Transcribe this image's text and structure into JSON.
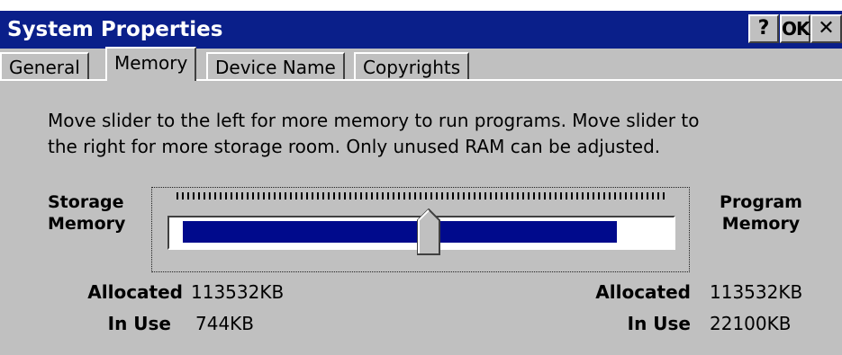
{
  "window": {
    "title": "System Properties",
    "buttons": {
      "help": "?",
      "ok": "OK",
      "close": "✕"
    }
  },
  "tabs": [
    {
      "label": "General",
      "active": false
    },
    {
      "label": "Memory",
      "active": true
    },
    {
      "label": "Device Name",
      "active": false
    },
    {
      "label": "Copyrights",
      "active": false
    }
  ],
  "memory": {
    "description_line1": "Move slider to the left for more memory to run programs. Move slider to",
    "description_line2": "the right for more storage room. Only unused RAM can be adjusted.",
    "storage_label_1": "Storage",
    "storage_label_2": "Memory",
    "program_label_1": "Program",
    "program_label_2": "Memory",
    "slider": {
      "position_fraction": 0.5,
      "used_fraction": 0.885
    },
    "storage": {
      "allocated_label": "Allocated",
      "allocated_value": "113532KB",
      "in_use_label": "In Use",
      "in_use_value": "744KB"
    },
    "program": {
      "allocated_label": "Allocated",
      "allocated_value": "113532KB",
      "in_use_label": "In Use",
      "in_use_value": "22100KB"
    }
  },
  "colors": {
    "titlebar": "#0a1f8a",
    "fill": "#000a8c",
    "face": "#c0c0c0"
  }
}
